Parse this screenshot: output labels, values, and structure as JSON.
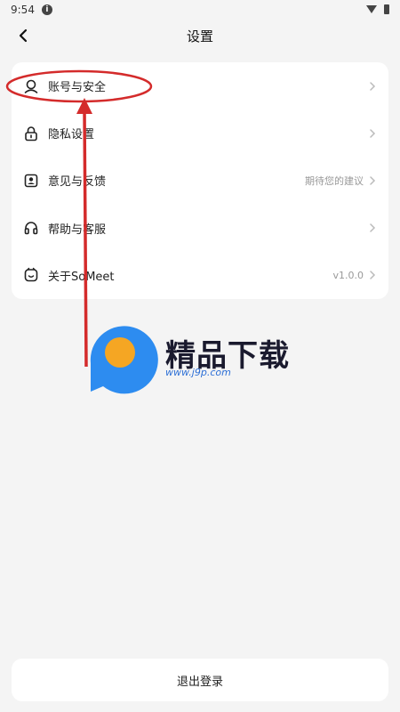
{
  "status_bar": {
    "time": "9:54"
  },
  "header": {
    "title": "设置",
    "back_icon": "chevron-left-icon"
  },
  "settings": {
    "items": [
      {
        "label": "账号与安全",
        "icon": "user-icon",
        "value": ""
      },
      {
        "label": "隐私设置",
        "icon": "lock-icon",
        "value": ""
      },
      {
        "label": "意见与反馈",
        "icon": "feedback-icon",
        "value": "期待您的建议"
      },
      {
        "label": "帮助与客服",
        "icon": "headphones-icon",
        "value": ""
      },
      {
        "label": "关于SoMeet",
        "icon": "smile-box-icon",
        "value": "v1.0.0"
      }
    ]
  },
  "logout": {
    "label": "退出登录"
  },
  "watermark": {
    "brand": "精品下载",
    "url": "www.j9p.com"
  },
  "colors": {
    "annotation": "#d42b2b",
    "watermark_blue": "#2d8cf0",
    "watermark_orange": "#f5a623"
  }
}
